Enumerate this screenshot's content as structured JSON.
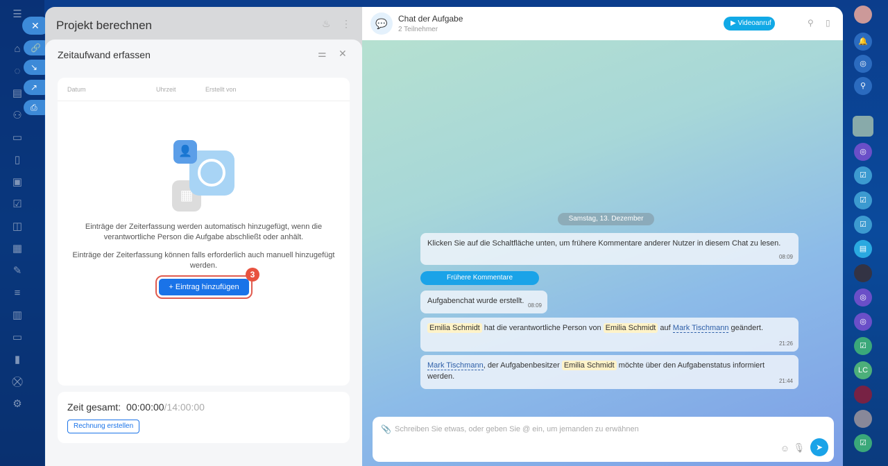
{
  "task": {
    "title": "Projekt berechnen"
  },
  "slide": {
    "title": "Zeitaufwand erfassen",
    "columns": [
      "Datum",
      "Uhrzeit",
      "Erstellt von"
    ],
    "empty_text_1": "Einträge der Zeiterfassung werden automatisch hinzugefügt, wenn die verantwortliche Person die Aufgabe abschließt oder anhält.",
    "empty_text_2": "Einträge der Zeiterfassung können falls erforderlich auch manuell hinzugefügt werden.",
    "add_button": "Eintrag hinzufügen",
    "step_badge": "3",
    "total_label": "Zeit gesamt:",
    "total_value": "00:00:00",
    "total_planned": "/14:00:00",
    "invoice_button": "Rechnung erstellen"
  },
  "chat": {
    "title": "Chat der Aufgabe",
    "subtitle": "2 Teilnehmer",
    "video_button": "Videoanruf",
    "date": "Samstag, 13. Dezember",
    "msg1": "Klicken Sie auf die Schaltfläche unten, um frühere Kommentare anderer Nutzer in diesem Chat zu lesen.",
    "msg1_time": "08:09",
    "more_button": "Frühere Kommentare",
    "msg2": "Aufgabenchat wurde erstellt.",
    "msg2_time": "08:09",
    "msg3": {
      "u1": "Emilia Schmidt",
      "t1": " hat die verantwortliche Person von ",
      "u2": "Emilia Schmidt",
      "t2": " auf ",
      "u3": "Mark Tischmann",
      "t3": " geändert.",
      "time": "21:26"
    },
    "msg4": {
      "u1": "Mark Tischmann",
      "t1": ", der Aufgabenbesitzer ",
      "u2": "Emilia Schmidt",
      "t2": " möchte über den Aufgabenstatus informiert werden.",
      "time": "21:44"
    },
    "placeholder": "Schreiben Sie etwas, oder geben Sie @ ein, um jemanden zu erwähnen"
  },
  "rail": {
    "initials": "LC"
  }
}
